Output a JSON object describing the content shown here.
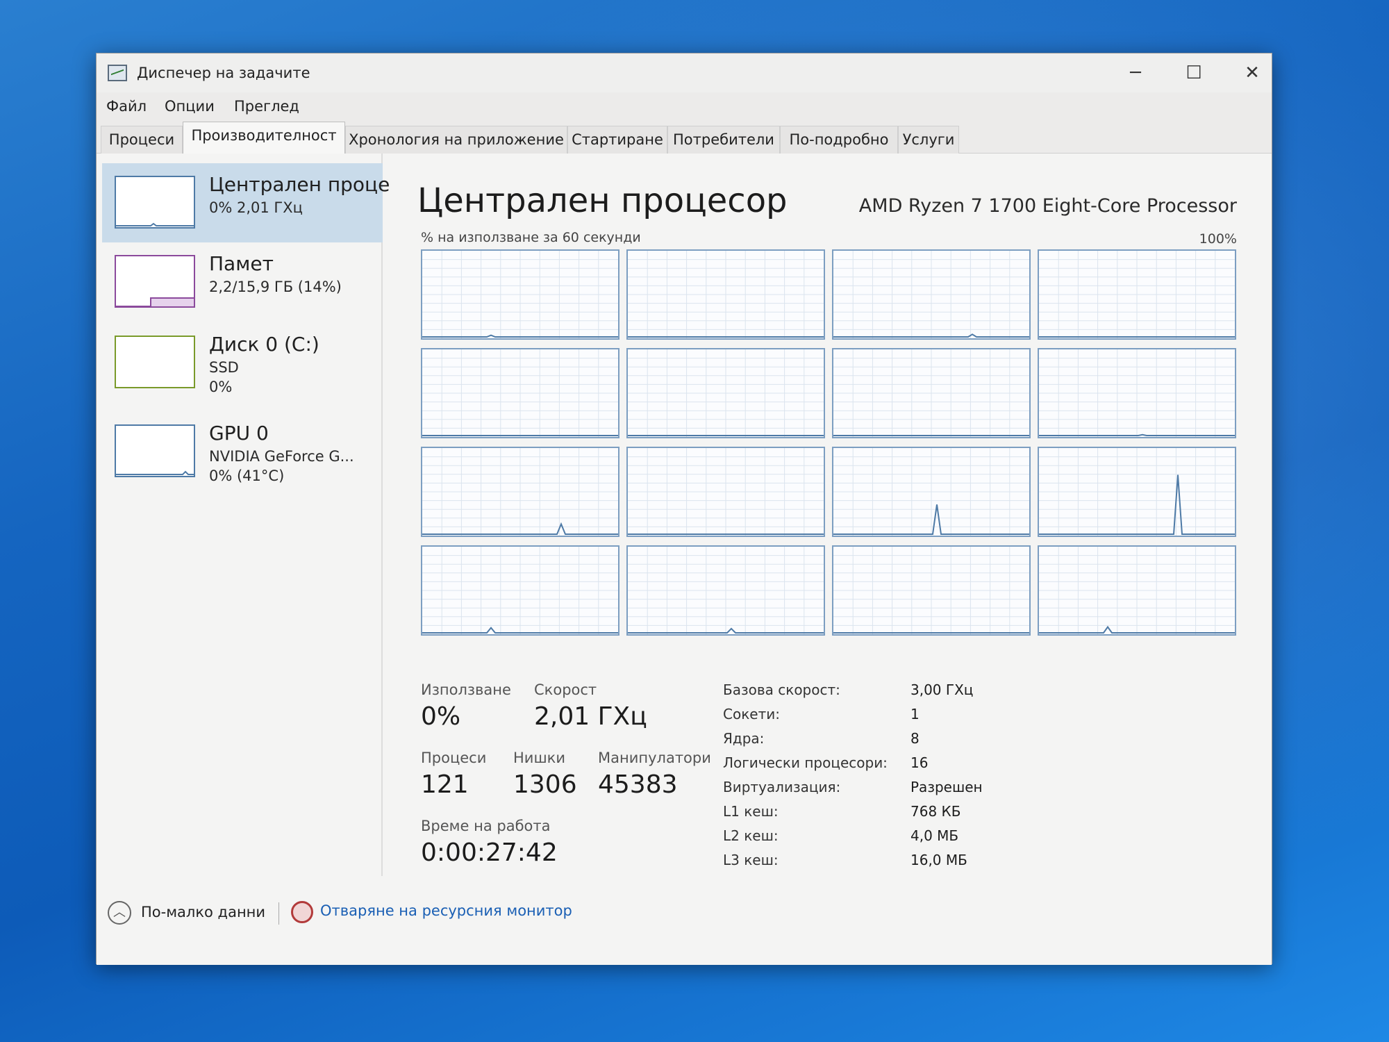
{
  "window": {
    "title": "Диспечер на задачите",
    "minimize": "─",
    "maximize": "☐",
    "close": "✕"
  },
  "menu": {
    "items": [
      "Файл",
      "Опции",
      "Преглед"
    ]
  },
  "tabs": [
    {
      "label": "Процеси",
      "active": false
    },
    {
      "label": "Производителност",
      "active": true
    },
    {
      "label": "Хронология на приложение",
      "active": false
    },
    {
      "label": "Стартиране",
      "active": false
    },
    {
      "label": "Потребители",
      "active": false
    },
    {
      "label": "По-подробно",
      "active": false
    },
    {
      "label": "Услуги",
      "active": false
    }
  ],
  "sidebar": {
    "items": [
      {
        "title": "Централен проце",
        "sub1": "0% 2,01 ГХц",
        "sub2": "",
        "color": "#4e7aa6"
      },
      {
        "title": "Памет",
        "sub1": "2,2/15,9 ГБ (14%)",
        "sub2": "",
        "color": "#8b4a9c"
      },
      {
        "title": "Диск 0 (C:)",
        "sub1": "SSD",
        "sub2": "0%",
        "color": "#7a9a2a"
      },
      {
        "title": "GPU 0",
        "sub1": "NVIDIA GeForce G...",
        "sub2": "0% (41°C)",
        "color": "#4e7aa6"
      }
    ]
  },
  "main": {
    "title": "Централен процесор",
    "cpu_model": "AMD Ryzen 7 1700 Eight-Core Processor",
    "graph_caption": "% на използване за 60 секунди",
    "graph_max": "100%",
    "logical_processor_peaks_percent": [
      2,
      0,
      3,
      0,
      0,
      0,
      0,
      1,
      12,
      0,
      35,
      70,
      6,
      5,
      0,
      7
    ]
  },
  "stats": {
    "usage_label": "Използване",
    "usage_value": "0%",
    "speed_label": "Скорост",
    "speed_value": "2,01 ГХц",
    "processes_label": "Процеси",
    "processes_value": "121",
    "threads_label": "Нишки",
    "threads_value": "1306",
    "handles_label": "Манипулатори",
    "handles_value": "45383",
    "uptime_label": "Време на работа",
    "uptime_value": "0:00:27:42"
  },
  "specs": [
    {
      "label": "Базова скорост:",
      "value": "3,00 ГХц"
    },
    {
      "label": "Сокети:",
      "value": "1"
    },
    {
      "label": "Ядра:",
      "value": "8"
    },
    {
      "label": "Логически процесори:",
      "value": "16"
    },
    {
      "label": "Виртуализация:",
      "value": "Разрешен"
    },
    {
      "label": "L1 кеш:",
      "value": "768 КБ"
    },
    {
      "label": "L2 кеш:",
      "value": "4,0 МБ"
    },
    {
      "label": "L3 кеш:",
      "value": "16,0 МБ"
    }
  ],
  "footer": {
    "fewer_details": "По-малко данни",
    "open_resmon": "Отваряне на ресурсния монитор"
  }
}
